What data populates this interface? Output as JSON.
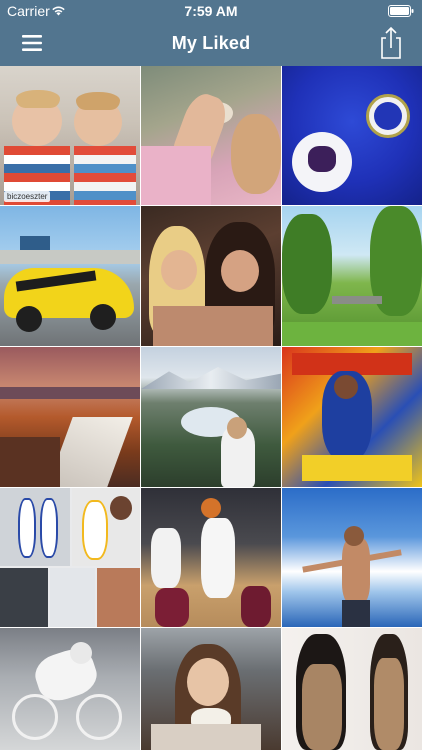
{
  "status_bar": {
    "carrier": "Carrier",
    "time": "7:59 AM",
    "wifi_icon": "wifi-icon",
    "battery_icon": "battery-icon"
  },
  "nav": {
    "title": "My Liked",
    "menu_icon": "hamburger-menu-icon",
    "share_icon": "share-icon"
  },
  "colors": {
    "header": "#52758f",
    "grid_gap": "#ffffff"
  },
  "photos": [
    {
      "id": "twin-boys",
      "caption": "biczoeszter"
    },
    {
      "id": "kids-with-hamster"
    },
    {
      "id": "chelsea-jersey"
    },
    {
      "id": "yellow-camaro"
    },
    {
      "id": "two-women-selfie"
    },
    {
      "id": "green-park"
    },
    {
      "id": "canyon-river"
    },
    {
      "id": "mountain-valley-woman"
    },
    {
      "id": "stephen-curry-poster"
    },
    {
      "id": "warriors-collage"
    },
    {
      "id": "basketball-game"
    },
    {
      "id": "man-on-boat"
    },
    {
      "id": "cyclist-sketch"
    },
    {
      "id": "woman-eating"
    },
    {
      "id": "mirror-selfie"
    }
  ]
}
